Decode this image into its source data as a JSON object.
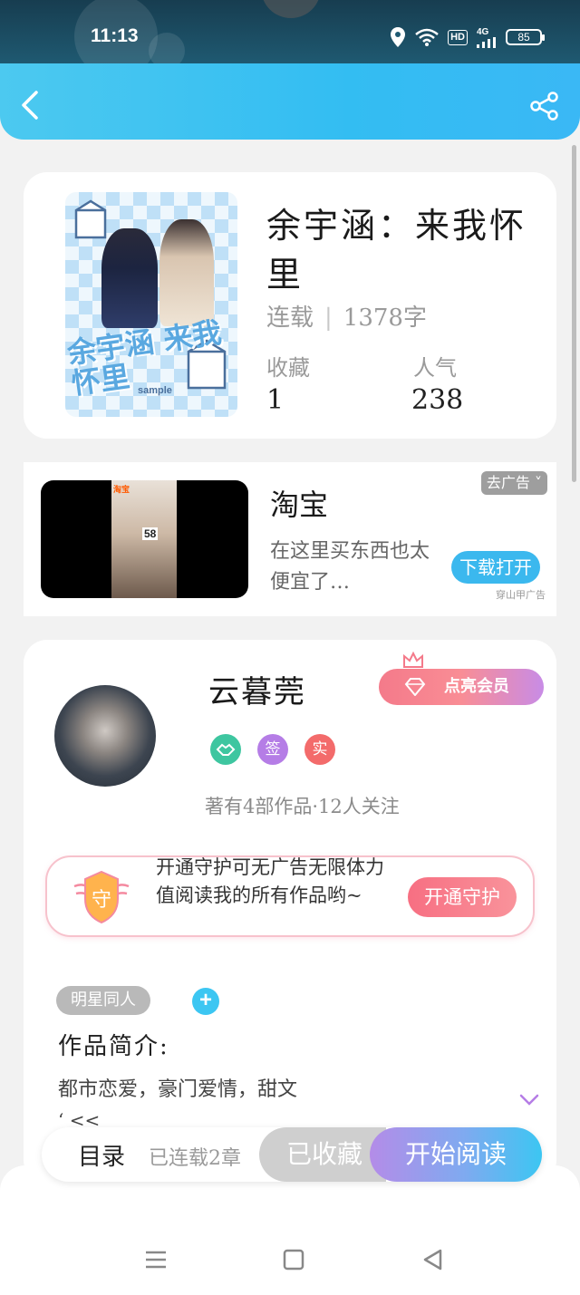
{
  "status_bar": {
    "time": "11:13",
    "hd": "HD",
    "network": "4G",
    "battery": "85"
  },
  "header": {
    "back_icon": "chevron-left-icon",
    "share_icon": "share-icon"
  },
  "book": {
    "cover_text": "余宇涵 来我怀里",
    "cover_sample": "sample",
    "title": "余宇涵：来我怀里",
    "status": "连载",
    "word_count": "1378字",
    "favorites_label": "收藏",
    "favorites_value": "1",
    "popularity_label": "人气",
    "popularity_value": "238"
  },
  "ad": {
    "frame_tag": "淘宝",
    "frame_price": "58",
    "remove_label": "去广告 ˅",
    "title": "淘宝",
    "description": "在这里买东西也太便宜了…",
    "button": "下载打开",
    "source": "穿山甲广告"
  },
  "author": {
    "name": "云暮莞",
    "vip_button": "点亮会员",
    "badges": [
      {
        "label": "",
        "color": "#3ec6a0",
        "icon": "handshake-icon"
      },
      {
        "label": "签",
        "color": "#b57de6"
      },
      {
        "label": "实",
        "color": "#f36b6b"
      }
    ],
    "stats": "著有4部作品·12人关注",
    "guard_shield": "守",
    "guard_text": "开通守护可无广告无限体力值阅读我的所有作品哟~",
    "guard_button": "开通守护",
    "tag": "明星同人",
    "add_tag": "+",
    "intro_label": "作品简介:",
    "intro_text": "都市恋爱，豪门爱情，甜文",
    "intro_more": "‘ <<"
  },
  "read_bar": {
    "toc": "目录",
    "chapters": "已连载2章",
    "collected": "已收藏",
    "start": "开始阅读"
  },
  "colors": {
    "accent": "#3cc6f2",
    "header_start": "#4cc9f0",
    "vip_pink": "#f47a8a"
  }
}
